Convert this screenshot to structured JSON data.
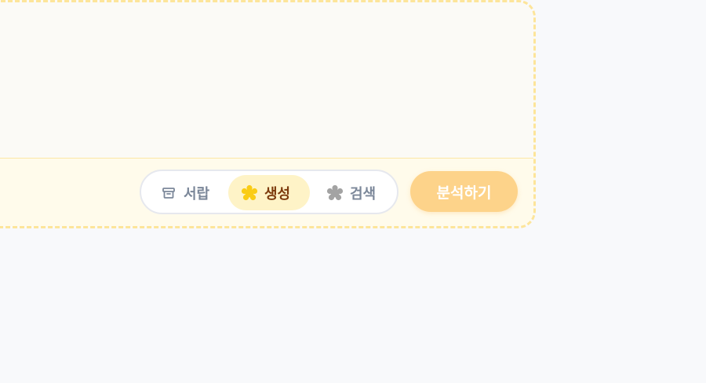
{
  "composer": {
    "modes": [
      {
        "label": "서랍",
        "icon": "archive-box-icon",
        "active": false
      },
      {
        "label": "생성",
        "icon": "sparkle-flower-icon",
        "active": true
      },
      {
        "label": "검색",
        "icon": "flower-icon",
        "active": false
      }
    ],
    "analyze_label": "분석하기"
  },
  "colors": {
    "accent": "#fdd38a",
    "active_mode_bg": "#fef3c7",
    "active_mode_text": "#7c3a0c",
    "border_dashed": "#fde59a",
    "generate_icon": "#facc15",
    "search_icon": "#a3a3a3"
  }
}
